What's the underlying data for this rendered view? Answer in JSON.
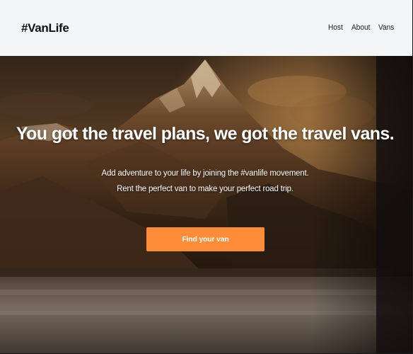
{
  "navbar": {
    "logo": "#VanLife",
    "links": [
      "Host",
      "About",
      "Vans"
    ]
  },
  "hero": {
    "title": "You got the travel plans, we got the travel vans.",
    "subtitle_lines": [
      "Add adventure to your life by joining the #vanlife movement.",
      "Rent the perfect van to make your perfect road trip."
    ],
    "cta_label": "Find your van"
  },
  "colors": {
    "navbar_bg": "#f4f5f7",
    "cta_bg": "#ff8c38",
    "text_dark": "#111111",
    "text_light": "#ffffff"
  }
}
